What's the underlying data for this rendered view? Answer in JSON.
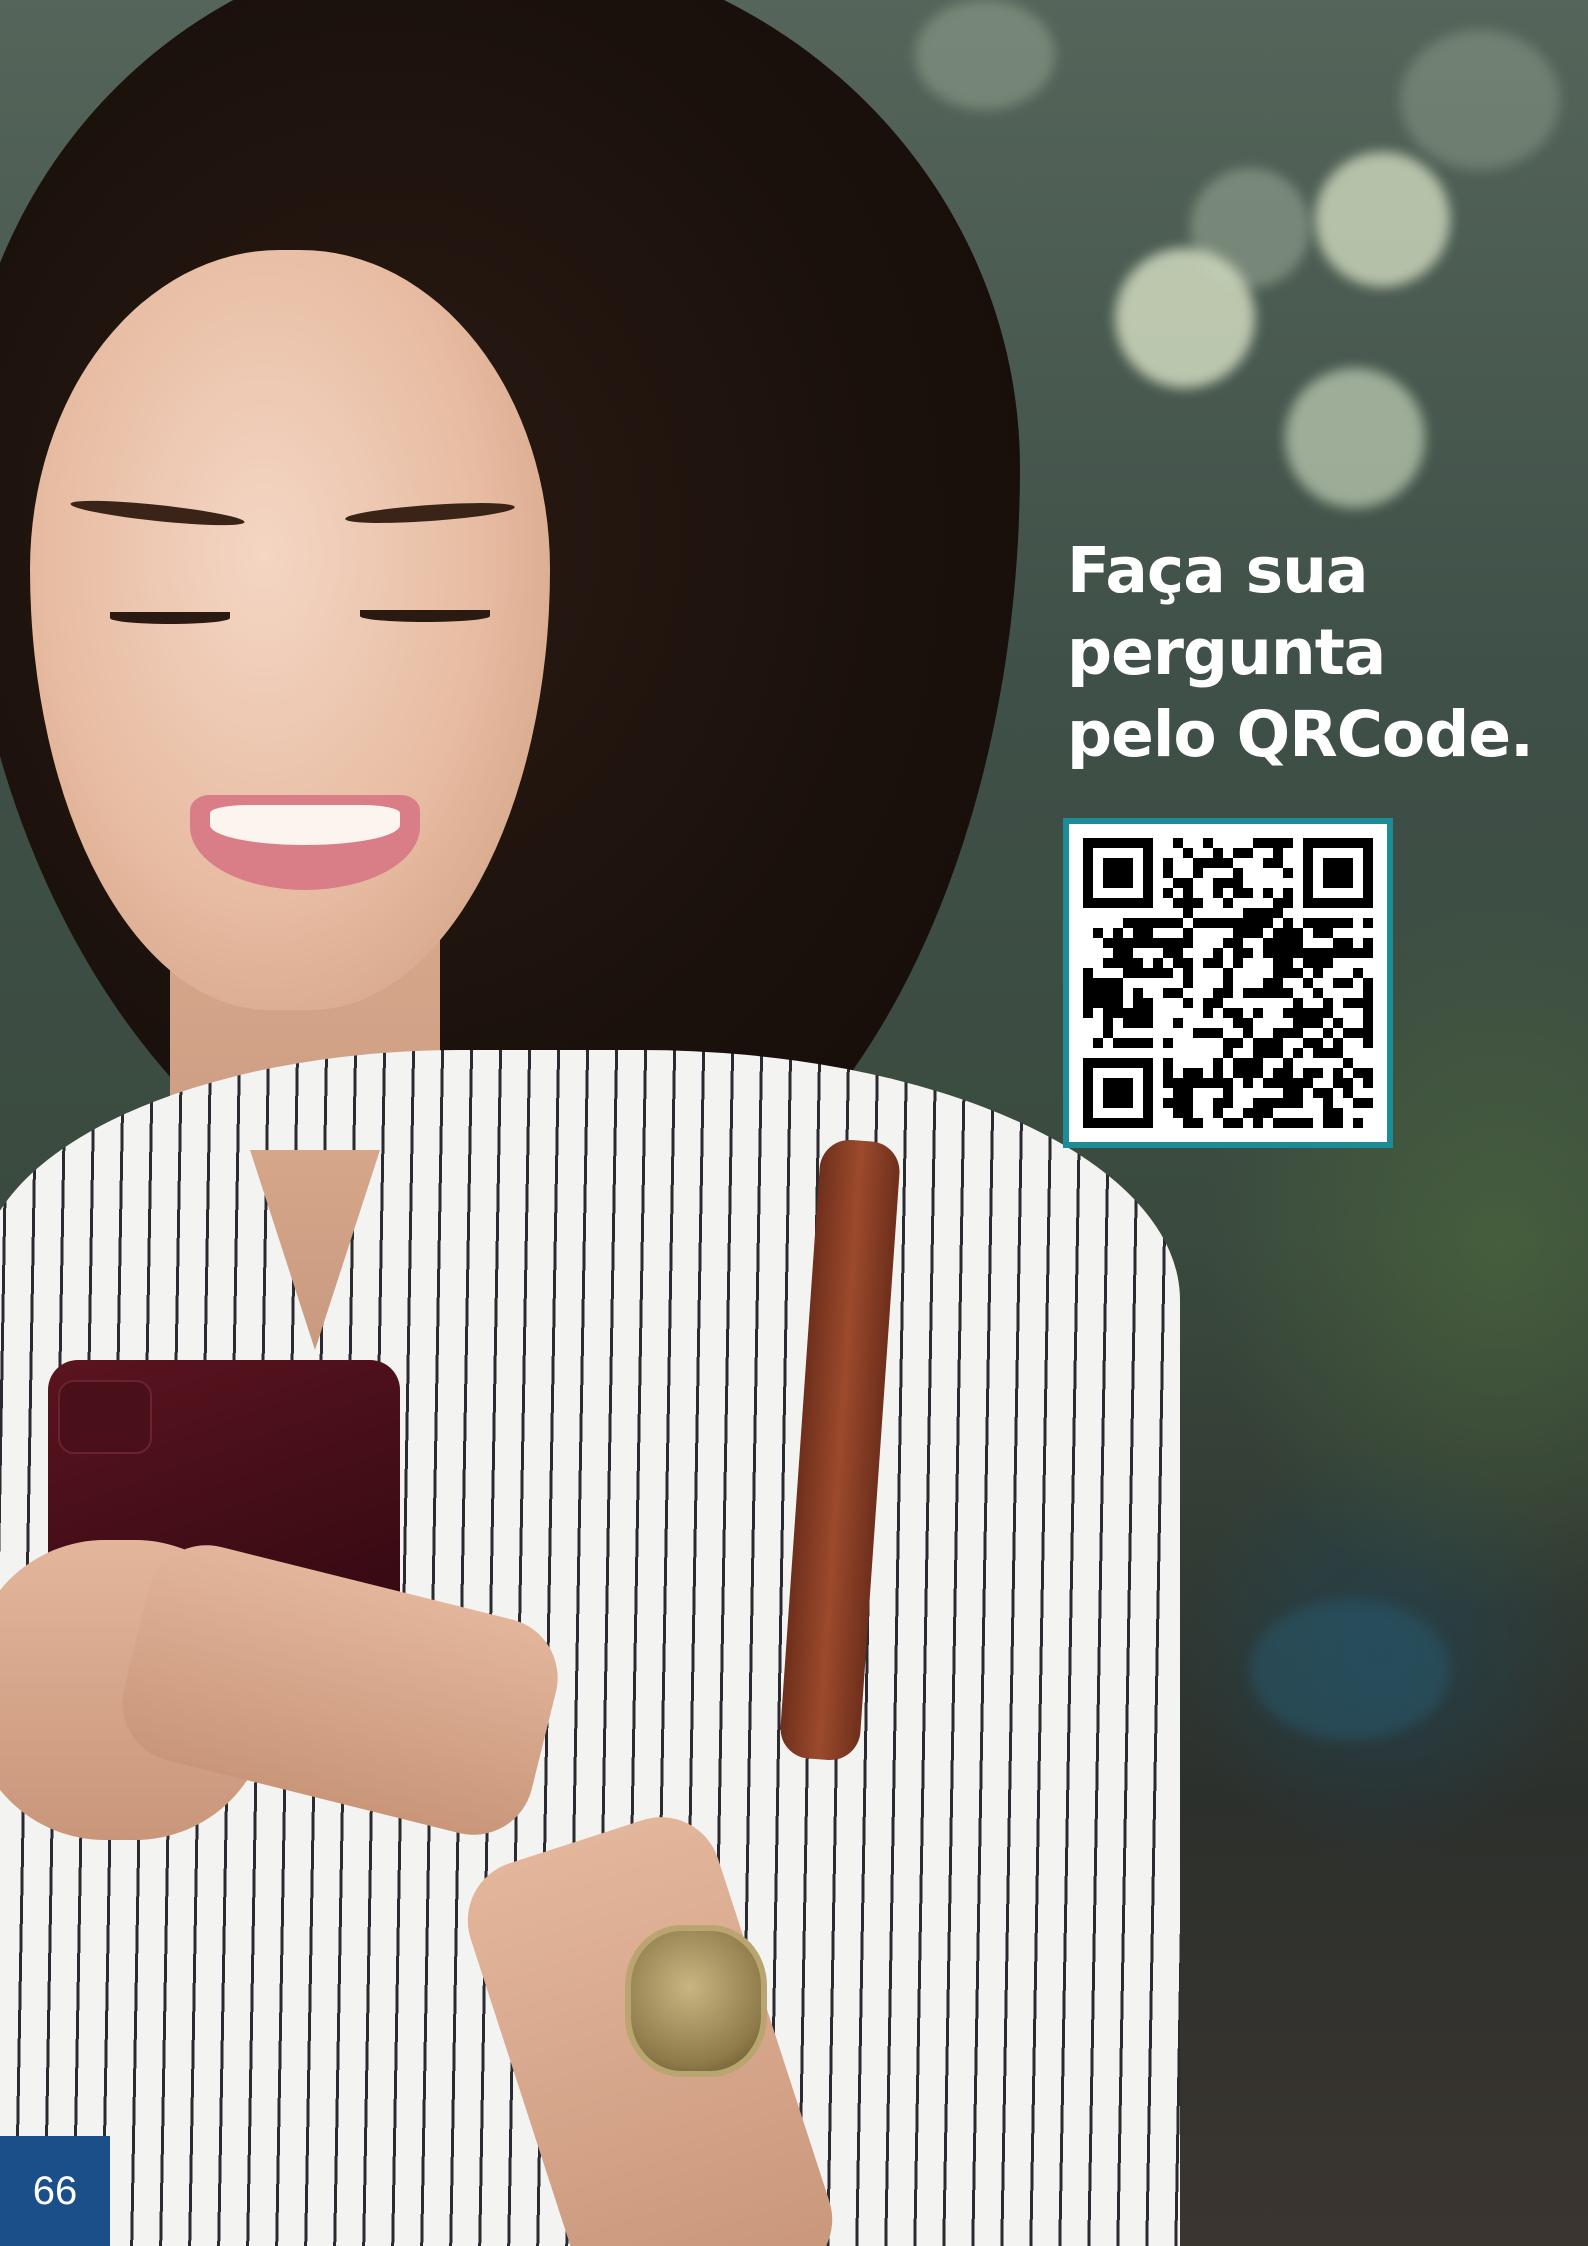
{
  "headline": {
    "line1": "Faça sua",
    "line2": "pergunta",
    "line3": "pelo QRCode."
  },
  "page_number": "66",
  "colors": {
    "qr_border": "#1c8c96",
    "page_tab": "#1a4f8a",
    "headline_text": "#ffffff"
  },
  "images": {
    "photo": "woman-smiling-with-smartphone",
    "qr": "qr-code"
  }
}
